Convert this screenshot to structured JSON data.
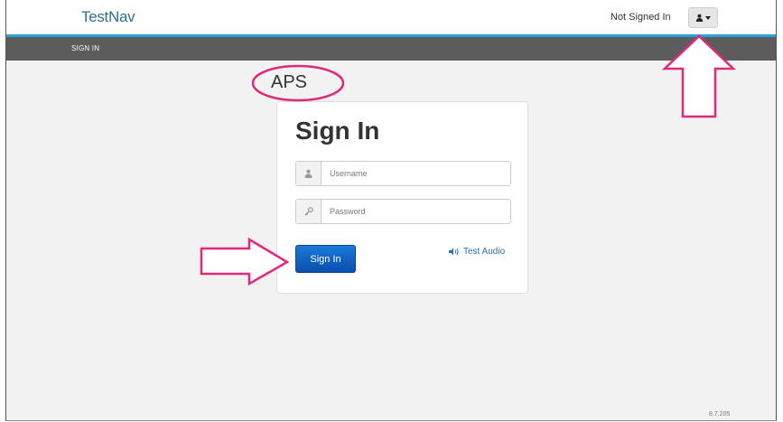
{
  "header": {
    "logo": "TestNav",
    "status": "Not Signed In",
    "user_menu_icon": "user-icon"
  },
  "nav": {
    "items": [
      {
        "label": "SIGN IN"
      }
    ]
  },
  "annotation": {
    "label": "APS",
    "highlight_color": "#e0297a"
  },
  "signin": {
    "title": "Sign In",
    "username_placeholder": "Username",
    "password_placeholder": "Password",
    "button_label": "Sign In",
    "audio_label": "Test Audio",
    "accent_color": "#0d5fc1"
  },
  "footer": {
    "version": "8.7.205"
  }
}
